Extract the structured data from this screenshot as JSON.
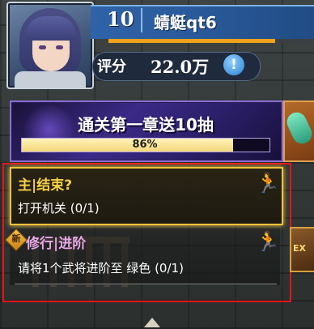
{
  "player": {
    "level": "10",
    "name": "蜻蜓qt6",
    "exp_progress": 0.81,
    "score_label": "评分",
    "score_value": "22.0万",
    "info_glyph": "!"
  },
  "banner": {
    "title": "通关第一章送10抽",
    "progress": 0.86,
    "progress_text": "86%"
  },
  "tasks": [
    {
      "title": "主|结束?",
      "desc": "打开机关 (0/1)",
      "icon": "running-man-icon",
      "highlighted": true
    },
    {
      "badge": "新",
      "title": "修行|进阶",
      "desc": "请将1个武将进阶至 绿色 (0/1)",
      "icon": "running-man-icon",
      "highlighted": false
    }
  ],
  "side": {
    "ex_label": "EX"
  },
  "colors": {
    "level_bar": "#2f63a8",
    "exp_fill": "#f0a21a",
    "task_highlight": "#f1c33a",
    "task1_title": "#f6d046",
    "task2_title": "#e7a6e6",
    "outline": "#e3151b"
  }
}
